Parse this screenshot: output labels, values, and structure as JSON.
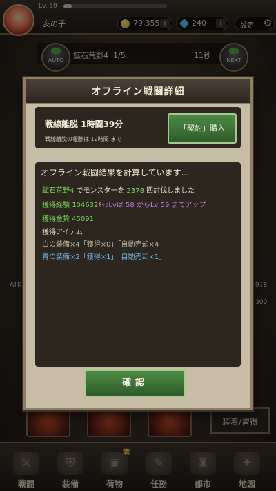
{
  "header": {
    "level": "Lv. 59",
    "player_name": "亥の子",
    "gold": "79,355",
    "gems": "240",
    "settings_label": "設定"
  },
  "stage": {
    "name": "鉱石荒野4",
    "progress": "1/5",
    "timer": "11秒",
    "auto_label": "AUTO",
    "next_label": "NEXT"
  },
  "background": {
    "left_label": "ATK",
    "right_value": "978",
    "right_count": "300",
    "equip_button": "装着/習得"
  },
  "nav": {
    "items": [
      {
        "label": "戦闘",
        "icon": "battle-icon"
      },
      {
        "label": "装備",
        "icon": "equipment-icon"
      },
      {
        "label": "荷物",
        "icon": "bag-icon"
      },
      {
        "label": "任務",
        "icon": "quest-icon"
      },
      {
        "label": "都市",
        "icon": "city-icon"
      },
      {
        "label": "地図",
        "icon": "map-icon"
      }
    ],
    "bag_badge": "満"
  },
  "modal": {
    "title": "オフライン戦闘詳細",
    "offline_time": "戦線離脱 1時間39分",
    "limit_note": "戦線離脱の報酬は 12時間 まで",
    "buy_button": "「契約」購入",
    "calculating": "オフライン戦闘結果を計算しています...",
    "kills": {
      "stage": "鉱石荒野4",
      "mid": " でモンスターを ",
      "count": "2378",
      "end": " 匹討伐しました"
    },
    "exp": {
      "prefix": "獲得経験 ",
      "amount": "104632",
      "unit": "ｷｬﾗLvは",
      "from_lv": " 58 からLv 59 までアップ"
    },
    "gold": {
      "prefix": "獲得金貨 ",
      "amount": "45091"
    },
    "items_header": "獲得アイテム",
    "item_white": "白の装備×4「獲得×0」「自動売却×4」",
    "item_blue": "青の装備×2「獲得×1」「自動売却×1」",
    "confirm_button": "確認"
  }
}
